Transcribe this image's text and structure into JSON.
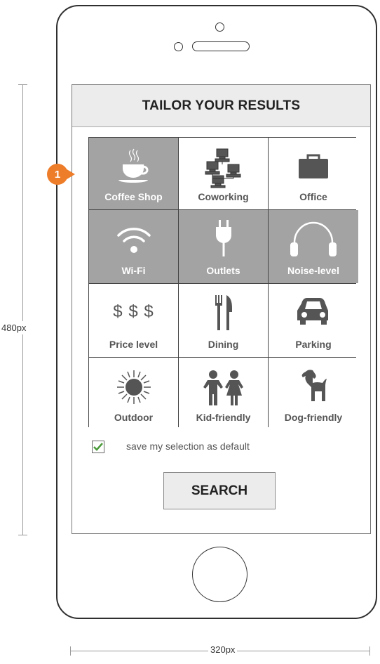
{
  "annotations": {
    "height_label": "480px",
    "width_label": "320px"
  },
  "callout": {
    "number": "1",
    "color": "#ee7d2a"
  },
  "screen": {
    "title": "TAILOR YOUR RESULTS",
    "options": [
      {
        "label": "Coffee Shop",
        "icon": "coffee-cup-icon",
        "selected": true
      },
      {
        "label": "Coworking",
        "icon": "network-computers-icon",
        "selected": false
      },
      {
        "label": "Office",
        "icon": "briefcase-icon",
        "selected": false
      },
      {
        "label": "Wi-Fi",
        "icon": "wifi-icon",
        "selected": true
      },
      {
        "label": "Outlets",
        "icon": "plug-icon",
        "selected": true
      },
      {
        "label": "Noise-level",
        "icon": "headphones-icon",
        "selected": true
      },
      {
        "label": "Price level",
        "icon": "dollar-signs-icon",
        "selected": false
      },
      {
        "label": "Dining",
        "icon": "fork-knife-icon",
        "selected": false
      },
      {
        "label": "Parking",
        "icon": "car-icon",
        "selected": false
      },
      {
        "label": "Outdoor",
        "icon": "sun-icon",
        "selected": false
      },
      {
        "label": "Kid-friendly",
        "icon": "children-icon",
        "selected": false
      },
      {
        "label": "Dog-friendly",
        "icon": "dog-icon",
        "selected": false
      }
    ],
    "price_symbols": "$ $ $",
    "save_default": {
      "label": "save my selection as default",
      "checked": true
    },
    "search_label": "SEARCH"
  },
  "colors": {
    "selected": "#a3a3a3",
    "check": "#4a9a3a"
  }
}
